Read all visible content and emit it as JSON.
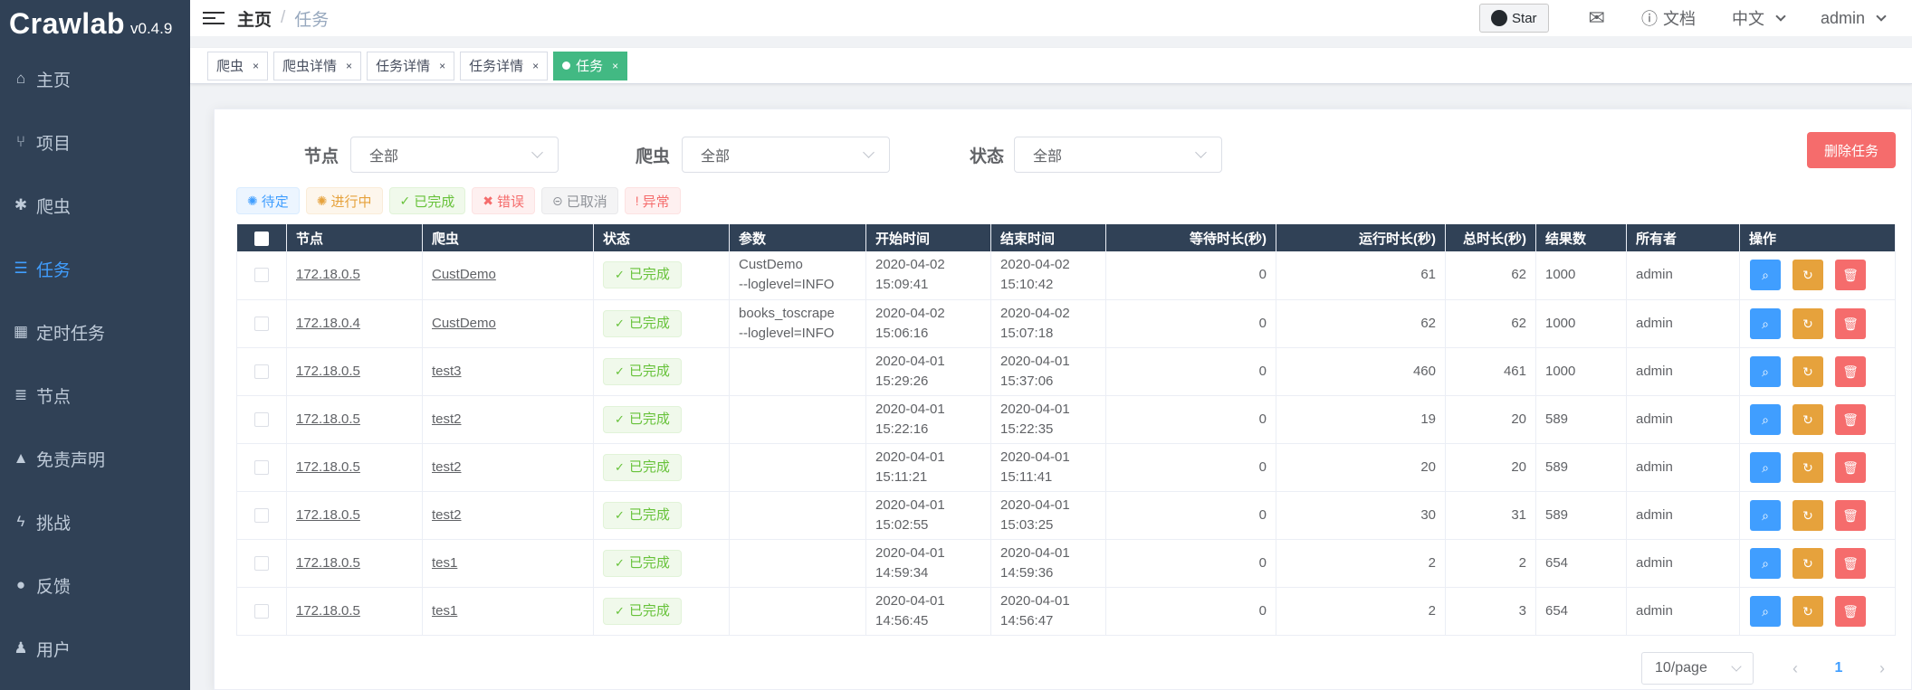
{
  "app": {
    "name": "Crawlab",
    "version": "v0.4.9"
  },
  "sidebar": {
    "items": [
      {
        "label": "主页",
        "icon": "home-icon"
      },
      {
        "label": "项目",
        "icon": "code-fork-icon"
      },
      {
        "label": "爬虫",
        "icon": "bug-icon"
      },
      {
        "label": "任务",
        "icon": "list-icon",
        "active": true
      },
      {
        "label": "定时任务",
        "icon": "calendar-icon"
      },
      {
        "label": "节点",
        "icon": "server-icon"
      },
      {
        "label": "免责声明",
        "icon": "warning-icon"
      },
      {
        "label": "挑战",
        "icon": "bolt-icon"
      },
      {
        "label": "反馈",
        "icon": "comment-icon"
      },
      {
        "label": "用户",
        "icon": "users-icon"
      }
    ]
  },
  "header": {
    "breadcrumb_home": "主页",
    "breadcrumb_sep": "/",
    "breadcrumb_current": "任务",
    "star_label": "Star",
    "docs_label": "文档",
    "language": "中文",
    "user": "admin"
  },
  "tags": [
    {
      "label": "爬虫"
    },
    {
      "label": "爬虫详情"
    },
    {
      "label": "任务详情"
    },
    {
      "label": "任务详情"
    },
    {
      "label": "任务",
      "active": true
    }
  ],
  "filters": {
    "node_label": "节点",
    "node_value": "全部",
    "spider_label": "爬虫",
    "spider_value": "全部",
    "status_label": "状态",
    "status_value": "全部"
  },
  "delete_button": "删除任务",
  "status_tags": [
    {
      "label": "待定",
      "icon": "✺",
      "cls": "st-pending"
    },
    {
      "label": "进行中",
      "icon": "✺",
      "cls": "st-running"
    },
    {
      "label": "已完成",
      "icon": "✓",
      "cls": "st-finished"
    },
    {
      "label": "错误",
      "icon": "✖",
      "cls": "st-error"
    },
    {
      "label": "已取消",
      "icon": "⊝",
      "cls": "st-cancelled"
    },
    {
      "label": "异常",
      "icon": "!",
      "cls": "st-abnormal"
    }
  ],
  "table": {
    "columns": [
      "节点",
      "爬虫",
      "状态",
      "参数",
      "开始时间",
      "结束时间",
      "等待时长(秒)",
      "运行时长(秒)",
      "总时长(秒)",
      "结果数",
      "所有者",
      "操作"
    ],
    "rows": [
      {
        "node": "172.18.0.5",
        "spider": "CustDemo",
        "status": "已完成",
        "param1": "CustDemo",
        "param2": "--loglevel=INFO",
        "start_date": "2020-04-02",
        "start_time": "15:09:41",
        "end_date": "2020-04-02",
        "end_time": "15:10:42",
        "wait": "0",
        "run": "61",
        "total": "62",
        "results": "1000",
        "owner": "admin"
      },
      {
        "node": "172.18.0.4",
        "spider": "CustDemo",
        "status": "已完成",
        "param1": "books_toscrape",
        "param2": "--loglevel=INFO",
        "start_date": "2020-04-02",
        "start_time": "15:06:16",
        "end_date": "2020-04-02",
        "end_time": "15:07:18",
        "wait": "0",
        "run": "62",
        "total": "62",
        "results": "1000",
        "owner": "admin"
      },
      {
        "node": "172.18.0.5",
        "spider": "test3",
        "status": "已完成",
        "param1": "",
        "param2": "",
        "start_date": "2020-04-01",
        "start_time": "15:29:26",
        "end_date": "2020-04-01",
        "end_time": "15:37:06",
        "wait": "0",
        "run": "460",
        "total": "461",
        "results": "1000",
        "owner": "admin"
      },
      {
        "node": "172.18.0.5",
        "spider": "test2",
        "status": "已完成",
        "param1": "",
        "param2": "",
        "start_date": "2020-04-01",
        "start_time": "15:22:16",
        "end_date": "2020-04-01",
        "end_time": "15:22:35",
        "wait": "0",
        "run": "19",
        "total": "20",
        "results": "589",
        "owner": "admin"
      },
      {
        "node": "172.18.0.5",
        "spider": "test2",
        "status": "已完成",
        "param1": "",
        "param2": "",
        "start_date": "2020-04-01",
        "start_time": "15:11:21",
        "end_date": "2020-04-01",
        "end_time": "15:11:41",
        "wait": "0",
        "run": "20",
        "total": "20",
        "results": "589",
        "owner": "admin"
      },
      {
        "node": "172.18.0.5",
        "spider": "test2",
        "status": "已完成",
        "param1": "",
        "param2": "",
        "start_date": "2020-04-01",
        "start_time": "15:02:55",
        "end_date": "2020-04-01",
        "end_time": "15:03:25",
        "wait": "0",
        "run": "30",
        "total": "31",
        "results": "589",
        "owner": "admin"
      },
      {
        "node": "172.18.0.5",
        "spider": "tes1",
        "status": "已完成",
        "param1": "",
        "param2": "",
        "start_date": "2020-04-01",
        "start_time": "14:59:34",
        "end_date": "2020-04-01",
        "end_time": "14:59:36",
        "wait": "0",
        "run": "2",
        "total": "2",
        "results": "654",
        "owner": "admin"
      },
      {
        "node": "172.18.0.5",
        "spider": "tes1",
        "status": "已完成",
        "param1": "",
        "param2": "",
        "start_date": "2020-04-01",
        "start_time": "14:56:45",
        "end_date": "2020-04-01",
        "end_time": "14:56:47",
        "wait": "0",
        "run": "2",
        "total": "3",
        "results": "654",
        "owner": "admin"
      }
    ]
  },
  "pagination": {
    "page_size": "10/page",
    "current_page": "1"
  },
  "colors": {
    "sidebar_bg": "#304156",
    "primary": "#409eff",
    "success": "#67c23a",
    "warning": "#e6a23c",
    "danger": "#f56c6c",
    "tag_active": "#42b983"
  }
}
